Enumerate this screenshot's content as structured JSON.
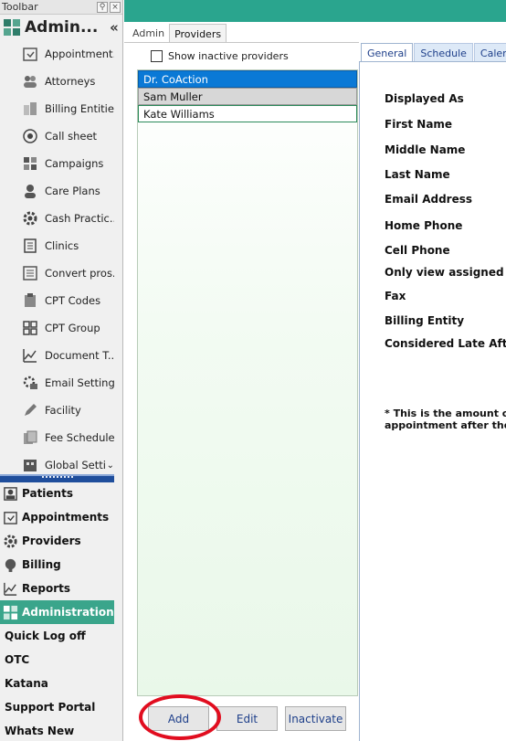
{
  "toolbar": {
    "title": "Toolbar",
    "header_title": "Admin...",
    "collapse_glyph": "«",
    "sub_items": [
      {
        "label": "Appointment...",
        "icon": "appointment-icon"
      },
      {
        "label": "Attorneys",
        "icon": "people-icon"
      },
      {
        "label": "Billing Entities",
        "icon": "buildings-icon"
      },
      {
        "label": "Call sheet",
        "icon": "target-icon"
      },
      {
        "label": "Campaigns",
        "icon": "puzzle-icon"
      },
      {
        "label": "Care Plans",
        "icon": "person-icon"
      },
      {
        "label": "Cash Practic...",
        "icon": "gear-icon"
      },
      {
        "label": "Clinics",
        "icon": "list-icon"
      },
      {
        "label": "Convert pros...",
        "icon": "document-list-icon"
      },
      {
        "label": "CPT Codes",
        "icon": "clipboard-icon"
      },
      {
        "label": "CPT Group",
        "icon": "grid-icon"
      },
      {
        "label": "Document T...",
        "icon": "chart-icon"
      },
      {
        "label": "Email Settings",
        "icon": "email-gear-icon"
      },
      {
        "label": "Facility",
        "icon": "pencil-icon"
      },
      {
        "label": "Fee Schedules",
        "icon": "documents-icon"
      },
      {
        "label": "Global Setti",
        "icon": "building-icon"
      }
    ],
    "main_items": [
      {
        "label": "Patients",
        "icon": "patients-icon"
      },
      {
        "label": "Appointments",
        "icon": "appointments-icon"
      },
      {
        "label": "Providers",
        "icon": "gear-icon"
      },
      {
        "label": "Billing",
        "icon": "billing-icon"
      },
      {
        "label": "Reports",
        "icon": "reports-icon"
      },
      {
        "label": "Administration",
        "icon": "puzzle-icon"
      },
      {
        "label": "Quick Log off"
      },
      {
        "label": "OTC"
      },
      {
        "label": "Katana"
      },
      {
        "label": "Support Portal"
      },
      {
        "label": "Whats New"
      }
    ]
  },
  "tabs": [
    "Admin",
    "Providers"
  ],
  "active_tab": "Providers",
  "show_inactive_label": "Show inactive providers",
  "providers": [
    "Dr. CoAction",
    "Sam Muller",
    "Kate Williams"
  ],
  "buttons": {
    "add": "Add",
    "edit": "Edit",
    "inactivate": "Inactivate"
  },
  "detail": {
    "tabs": [
      "General",
      "Schedule",
      "Calend"
    ],
    "fields": [
      "Displayed As",
      "First Name",
      "Middle Name",
      "Last Name",
      "Email Address",
      "Home Phone",
      "Cell Phone",
      "Only view assigned pa",
      "Fax",
      "Billing Entity",
      "Considered Late After"
    ],
    "footnote_line1": "* This is the amount of t",
    "footnote_line2": "appointment after the s"
  },
  "colors": {
    "accent_green": "#2aa58e",
    "selection_blue": "#0a79d6",
    "annotation_red": "#e10d1f"
  }
}
